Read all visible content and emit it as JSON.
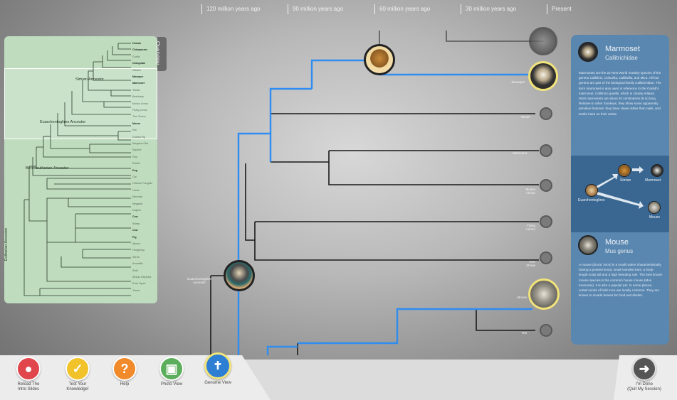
{
  "timeline": {
    "labels": [
      "120 million years ago",
      "90 million years ago",
      "60 million years ago",
      "30 million years ago",
      "Present"
    ]
  },
  "tree": {
    "ancestors": {
      "simian": "Simian\nAncestor",
      "euarchontoglires": "Euarchontoglires\nAncestor"
    },
    "leaves": [
      "Macaque",
      "Marmoset",
      "Tarsier",
      "Mouse\nLemur",
      "Flying\nLemur",
      "Tree\nShrew",
      "Mouse",
      "Rat"
    ],
    "colors": {
      "highlight": "#2f8cf0",
      "branch": "#1a1a1a",
      "panel_blue": "#5a87b0",
      "panel_green": "#bfdcbf"
    }
  },
  "overview": {
    "tab_label": "Overview",
    "species": [
      {
        "name": "Human",
        "bold": true
      },
      {
        "name": "Chimpanzee",
        "bold": true
      },
      {
        "name": "Gorilla",
        "bold": false
      },
      {
        "name": "Orangutan",
        "bold": true
      },
      {
        "name": "Gibbon",
        "bold": false
      },
      {
        "name": "Macaque",
        "bold": true
      },
      {
        "name": "Marmoset",
        "bold": true
      },
      {
        "name": "Tarsier",
        "bold": false
      },
      {
        "name": "Bushbaby",
        "bold": false
      },
      {
        "name": "Mouse Lemur",
        "bold": false
      },
      {
        "name": "Flying Lemur",
        "bold": false
      },
      {
        "name": "Tree Shrew",
        "bold": false
      },
      {
        "name": "Mouse",
        "bold": true
      },
      {
        "name": "Rat",
        "bold": false
      },
      {
        "name": "Guinea Pig",
        "bold": false
      },
      {
        "name": "Kangaroo Rat",
        "bold": false
      },
      {
        "name": "Squirrel",
        "bold": false
      },
      {
        "name": "Pika",
        "bold": false
      },
      {
        "name": "Rabbit",
        "bold": false
      },
      {
        "name": "Dog",
        "bold": true
      },
      {
        "name": "Cat",
        "bold": false
      },
      {
        "name": "Chinese Pangolin",
        "bold": false
      },
      {
        "name": "Horse",
        "bold": false
      },
      {
        "name": "Microbat",
        "bold": false
      },
      {
        "name": "Megabat",
        "bold": false
      },
      {
        "name": "Dolphin",
        "bold": false
      },
      {
        "name": "Cow",
        "bold": true
      },
      {
        "name": "Sheep",
        "bold": false
      },
      {
        "name": "Cow",
        "bold": true
      },
      {
        "name": "Pig",
        "bold": true
      },
      {
        "name": "Alpaca",
        "bold": false
      },
      {
        "name": "Hedgehog",
        "bold": false
      },
      {
        "name": "Shrew",
        "bold": false
      },
      {
        "name": "Armadillo",
        "bold": false
      },
      {
        "name": "Sloth",
        "bold": false
      },
      {
        "name": "African Elephant",
        "bold": false
      },
      {
        "name": "Rock Hyrax",
        "bold": false
      },
      {
        "name": "Tenrec",
        "bold": false
      }
    ],
    "ancestors": {
      "simian": "Simian Ancestor",
      "euarchontoglires": "Euarchontoglires Ancestor",
      "boreoeutherian": "Boreoeutherian Ancestor",
      "eutherian": "Eutherian Ancestor"
    }
  },
  "info": {
    "top": {
      "title": "Marmoset",
      "subtitle": "Callitrichidae",
      "text": "Marmosets are the 22 New World monkey species of the genera Callithrix, Cebuella, Callibella, and Mico. All four genera are part of the biological family Callitrichidae. The term marmoset is also used in reference to the Goeldi's marmoset, Callimico goeldii, which is closely related. Most marmosets are about 20 centimetres (8 in) long. Relative to other monkeys, they show some apparently primitive features: they have claws rather than nails, and tactile hairs on their wrists."
    },
    "mid": {
      "labels": [
        "Simian",
        "Marmoset",
        "Euarchontoglires",
        "Mouse"
      ]
    },
    "bottom": {
      "title": "Mouse",
      "subtitle": "Mus genus",
      "text": "A mouse (plural: mice) is a small rodent characteristically having a pointed snout, small rounded ears, a body-length scaly tail and a high breeding rate. The best known mouse species is the common house mouse (Mus musculus). It is also a popular pet. In some places, certain kinds of field mice are locally common. They are known to invade homes for food and shelter."
    }
  },
  "toolbar": {
    "buttons": [
      {
        "label": "Reload The\nIntro Slides",
        "color": "#e0464c"
      },
      {
        "label": "Test Your\nKnowledge!",
        "color": "#f2c22a"
      },
      {
        "label": "Help",
        "color": "#f08a2a"
      },
      {
        "label": "Photo View",
        "color": "#5cae5c"
      },
      {
        "label": "Genome View",
        "color": "#2e7fd4"
      }
    ],
    "done_label": "I'm Done\n(Quit My Session)"
  }
}
